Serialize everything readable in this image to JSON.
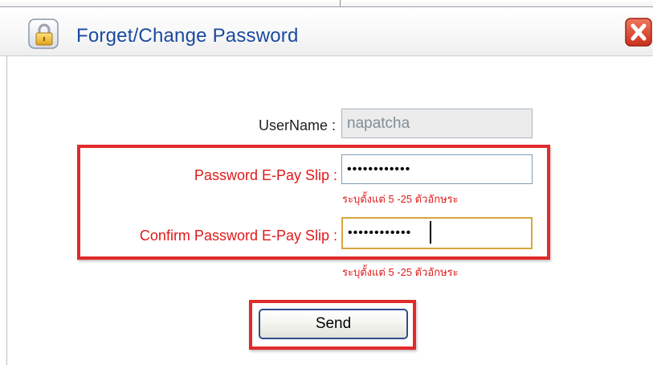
{
  "dialog": {
    "title": "Forget/Change Password",
    "close_icon": "close-icon",
    "lock_icon": "lock-icon"
  },
  "form": {
    "username_label": "UserName :",
    "username_value": "napatcha",
    "password_label": "Password E-Pay Slip :",
    "password_value": "••••••••••••",
    "password_hint": "ระบุตั้งแต่ 5 -25 ตัวอักษระ",
    "confirm_label": "Confirm Password E-Pay Slip :",
    "confirm_value": "••••••••••••",
    "confirm_hint": "ระบุตั้งแต่ 5 -25 ตัวอักษระ",
    "send_label": "Send"
  },
  "colors": {
    "title": "#1a4aa0",
    "required_label": "#e01a1a",
    "highlight": "#e12a2a",
    "close_red": "#d9442e"
  }
}
